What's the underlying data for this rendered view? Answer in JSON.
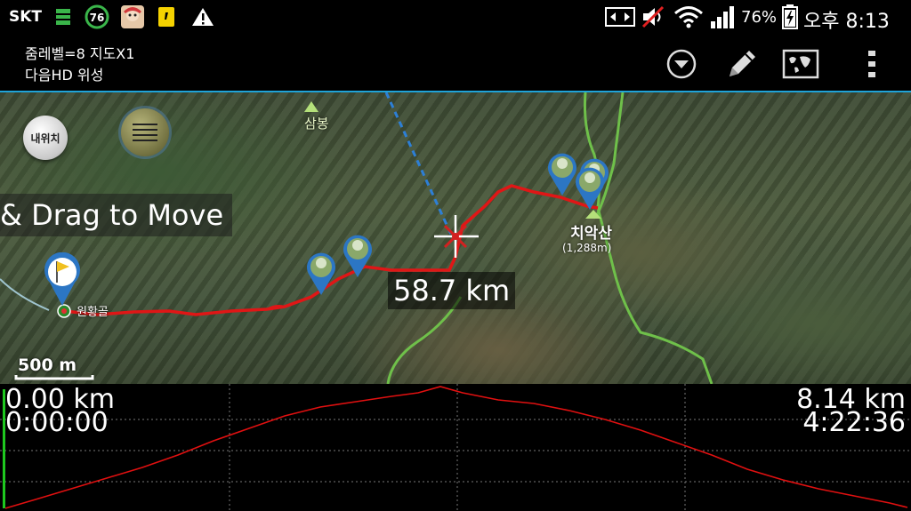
{
  "status_bar": {
    "carrier": "SKT",
    "badge_number": "76",
    "battery_percent": "76%",
    "time": "오후 8:13",
    "icons": [
      "sim-card-icon",
      "badge-76-icon",
      "avatar-app-icon",
      "note-icon",
      "warning-icon",
      "cast-icon",
      "mute-icon",
      "wifi-icon",
      "signal-icon",
      "battery-charging-icon"
    ]
  },
  "action_bar": {
    "line1": "줌레벨=8 지도X1",
    "line2": "다음HD 위성",
    "buttons": [
      "dropdown-icon",
      "pencil-icon",
      "map-layers-icon",
      "overflow-menu-icon"
    ]
  },
  "map": {
    "my_location_label": "내위치",
    "drag_hint": "& Drag to Move",
    "distance_label": "58.7 km",
    "peak_name": "치악산",
    "peak_elevation": "(1,288m)",
    "peak_sambong": "삼봉",
    "start_place": "원황골",
    "scale_label": "500 m",
    "colors": {
      "track": "#e01616",
      "trail": "#6fc04a",
      "guide_line": "#2d7fd6"
    }
  },
  "profile": {
    "start_distance": "0.00 km",
    "start_time": "0:00:00",
    "end_distance": "8.14 km",
    "end_time": "4:22:36",
    "line_color": "#e01010"
  }
}
